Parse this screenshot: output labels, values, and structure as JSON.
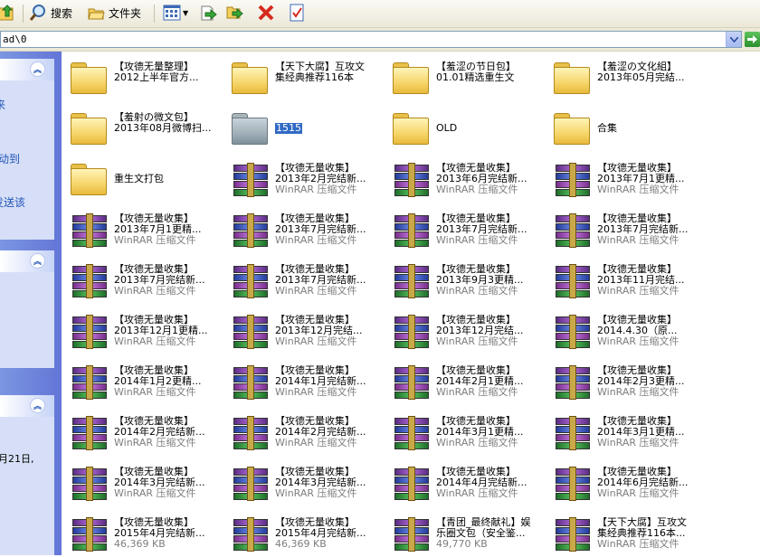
{
  "toolbar": {
    "search_label": "搜索",
    "folders_label": "文件夹"
  },
  "address": {
    "path": "ad\\0"
  },
  "taskpane": {
    "frag1": "来",
    "frag2": "动到",
    "frag3": "发送该",
    "frag4": "月21日,"
  },
  "files": [
    {
      "type": "folder",
      "l1": "【攻德无量整理】",
      "l2": "2012上半年官方...",
      "l3": ""
    },
    {
      "type": "folder",
      "l1": "【天下大腐】互攻文",
      "l2": "集经典推荐116本",
      "l3": ""
    },
    {
      "type": "folder",
      "l1": "【羞涩の节日包】",
      "l2": "01.01精选重生文",
      "l3": ""
    },
    {
      "type": "folder",
      "l1": "【羞涩の文化組】",
      "l2": "2013年05月完結...",
      "l3": ""
    },
    {
      "type": "folder",
      "l1": "【羞射の微文包】",
      "l2": "2013年08月微博扫...",
      "l3": ""
    },
    {
      "type": "folder-gray",
      "l1": "1515",
      "l2": "",
      "l3": "",
      "selected": true
    },
    {
      "type": "folder",
      "l1": "OLD",
      "l2": "",
      "l3": ""
    },
    {
      "type": "folder",
      "l1": "合集",
      "l2": "",
      "l3": ""
    },
    {
      "type": "folder",
      "l1": "重生文打包",
      "l2": "",
      "l3": ""
    },
    {
      "type": "rar",
      "l1": "【攻德无量收集】",
      "l2": "2013年2月完结新...",
      "l3": "WinRAR 压缩文件"
    },
    {
      "type": "rar",
      "l1": "【攻德无量收集】",
      "l2": "2013年6月完结新...",
      "l3": "WinRAR 压缩文件"
    },
    {
      "type": "rar",
      "l1": "【攻德无量收集】",
      "l2": "2013年7月1更精...",
      "l3": "WinRAR 压缩文件"
    },
    {
      "type": "rar",
      "l1": "【攻德无量收集】",
      "l2": "2013年7月1更精...",
      "l3": "WinRAR 压缩文件"
    },
    {
      "type": "rar",
      "l1": "【攻德无量收集】",
      "l2": "2013年7月完结新...",
      "l3": "WinRAR 压缩文件"
    },
    {
      "type": "rar",
      "l1": "【攻德无量收集】",
      "l2": "2013年7月完结新...",
      "l3": "WinRAR 压缩文件"
    },
    {
      "type": "rar",
      "l1": "【攻德无量收集】",
      "l2": "2013年7月完结新...",
      "l3": "WinRAR 压缩文件"
    },
    {
      "type": "rar",
      "l1": "【攻德无量收集】",
      "l2": "2013年7月完结新...",
      "l3": "WinRAR 压缩文件"
    },
    {
      "type": "rar",
      "l1": "【攻德无量收集】",
      "l2": "2013年7月完结新...",
      "l3": "WinRAR 压缩文件"
    },
    {
      "type": "rar",
      "l1": "【攻德无量收集】",
      "l2": "2013年9月3更精...",
      "l3": "WinRAR 压缩文件"
    },
    {
      "type": "rar",
      "l1": "【攻德无量收集】",
      "l2": "2013年11月完结...",
      "l3": "WinRAR 压缩文件"
    },
    {
      "type": "rar",
      "l1": "【攻德无量收集】",
      "l2": "2013年12月1更精...",
      "l3": "WinRAR 压缩文件"
    },
    {
      "type": "rar",
      "l1": "【攻德无量收集】",
      "l2": "2013年12月完结...",
      "l3": "WinRAR 压缩文件"
    },
    {
      "type": "rar",
      "l1": "【攻德无量收集】",
      "l2": "2013年12月完结...",
      "l3": "WinRAR 压缩文件"
    },
    {
      "type": "rar",
      "l1": "【攻德无量收集】",
      "l2": "2014.4.30（原...",
      "l3": "WinRAR 压缩文件"
    },
    {
      "type": "rar",
      "l1": "【攻德无量收集】",
      "l2": "2014年1月2更精...",
      "l3": "WinRAR 压缩文件"
    },
    {
      "type": "rar",
      "l1": "【攻德无量收集】",
      "l2": "2014年1月完结新...",
      "l3": "WinRAR 压缩文件"
    },
    {
      "type": "rar",
      "l1": "【攻德无量收集】",
      "l2": "2014年2月1更精...",
      "l3": "WinRAR 压缩文件"
    },
    {
      "type": "rar",
      "l1": "【攻德无量收集】",
      "l2": "2014年2月3更精...",
      "l3": "WinRAR 压缩文件"
    },
    {
      "type": "rar",
      "l1": "【攻德无量收集】",
      "l2": "2014年2月完结新...",
      "l3": "WinRAR 压缩文件"
    },
    {
      "type": "rar",
      "l1": "【攻德无量收集】",
      "l2": "2014年2月完结新...",
      "l3": "WinRAR 压缩文件"
    },
    {
      "type": "rar",
      "l1": "【攻德无量收集】",
      "l2": "2014年3月1更精...",
      "l3": "WinRAR 压缩文件"
    },
    {
      "type": "rar",
      "l1": "【攻德无量收集】",
      "l2": "2014年3月1更精...",
      "l3": "WinRAR 压缩文件"
    },
    {
      "type": "rar",
      "l1": "【攻德无量收集】",
      "l2": "2014年3月完结新...",
      "l3": "WinRAR 压缩文件"
    },
    {
      "type": "rar",
      "l1": "【攻德无量收集】",
      "l2": "2014年3月完结新...",
      "l3": "WinRAR 压缩文件"
    },
    {
      "type": "rar",
      "l1": "【攻德无量收集】",
      "l2": "2014年4月完结新...",
      "l3": "WinRAR 压缩文件"
    },
    {
      "type": "rar",
      "l1": "【攻德无量收集】",
      "l2": "2014年6月完结新...",
      "l3": "WinRAR 压缩文件"
    },
    {
      "type": "rar",
      "l1": "【攻德无量收集】",
      "l2": "2015年4月完结新...",
      "l3": "46,369 KB"
    },
    {
      "type": "rar",
      "l1": "【攻德无量收集】",
      "l2": "2015年4月完结新...",
      "l3": "46,369 KB"
    },
    {
      "type": "rar",
      "l1": "【青团_最终献礼】娱",
      "l2": "乐圈文包（安全鉴...",
      "l3": "49,770 KB"
    },
    {
      "type": "rar",
      "l1": "【天下大腐】互攻文",
      "l2": "集经典推荐116本...",
      "l3": "WinRAR 压缩文件"
    }
  ]
}
